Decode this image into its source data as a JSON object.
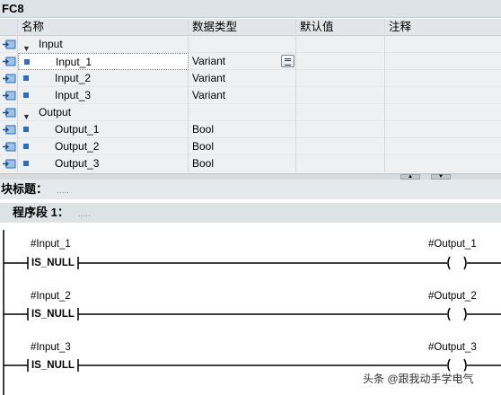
{
  "window": {
    "title": "FC8"
  },
  "interface": {
    "columns": {
      "name": "名称",
      "type": "数据类型",
      "default": "默认值",
      "comment": "注释"
    },
    "groups": [
      {
        "label": "Input"
      },
      {
        "label": "Output"
      }
    ],
    "inputs": [
      {
        "name": "Input_1",
        "type": "Variant"
      },
      {
        "name": "Input_2",
        "type": "Variant"
      },
      {
        "name": "Input_3",
        "type": "Variant"
      }
    ],
    "outputs": [
      {
        "name": "Output_1",
        "type": "Bool"
      },
      {
        "name": "Output_2",
        "type": "Bool"
      },
      {
        "name": "Output_3",
        "type": "Bool"
      }
    ]
  },
  "block": {
    "title_label": "块标题：",
    "title_dots": "....."
  },
  "network": {
    "title_label": "程序段 1：",
    "title_dots": "....."
  },
  "rungs": [
    {
      "operand_in": "#Input_1",
      "instruction": "IS_NULL",
      "operand_out": "#Output_1",
      "coil": "( )"
    },
    {
      "operand_in": "#Input_2",
      "instruction": "IS_NULL",
      "operand_out": "#Output_2",
      "coil": "( )"
    },
    {
      "operand_in": "#Input_3",
      "instruction": "IS_NULL",
      "operand_out": "#Output_3",
      "coil": "( )"
    }
  ],
  "watermark": "头条 @跟我动手学电气",
  "colors": {
    "header_bg": "#dde3e6",
    "pin_icon": "#2a6ebd",
    "selected_row": "#ffffff"
  }
}
